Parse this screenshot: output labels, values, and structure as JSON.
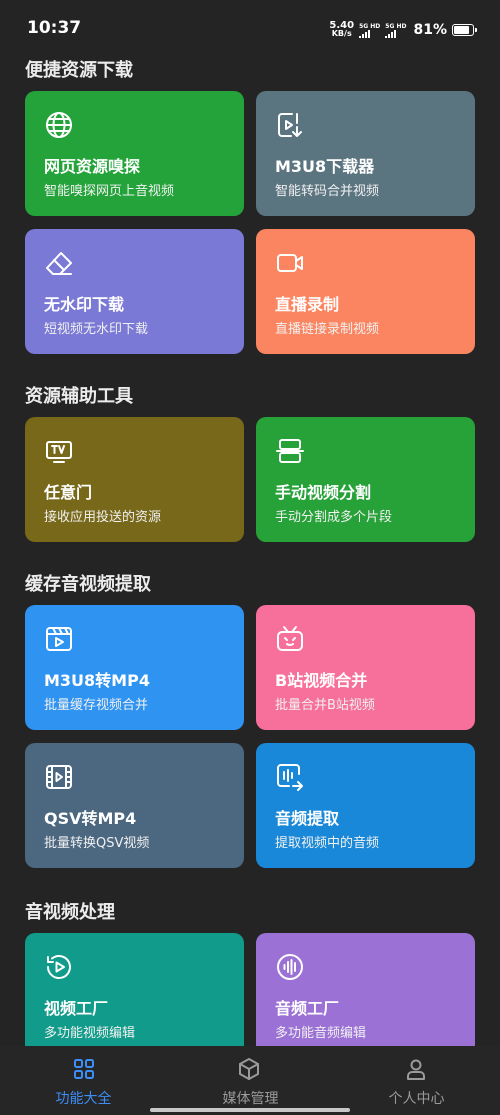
{
  "status": {
    "time": "10:37",
    "net_speed_value": "5.40",
    "net_speed_unit": "KB/s",
    "sim1_label": "5G HD",
    "sim2_label": "5G HD",
    "battery_percent": "81%",
    "battery_level": 0.81
  },
  "sections": [
    {
      "title": "便捷资源下载",
      "cards": [
        {
          "title": "网页资源嗅探",
          "subtitle": "智能嗅探网页上音视频",
          "color": "#24a33a",
          "icon": "globe-icon"
        },
        {
          "title": "M3U8下载器",
          "subtitle": "智能转码合并视频",
          "color": "#5a7480",
          "icon": "video-download-icon"
        },
        {
          "title": "无水印下载",
          "subtitle": "短视频无水印下载",
          "color": "#7a79d6",
          "icon": "eraser-icon"
        },
        {
          "title": "直播录制",
          "subtitle": "直播链接录制视频",
          "color": "#fb8560",
          "icon": "video-camera-icon"
        }
      ]
    },
    {
      "title": "资源辅助工具",
      "cards": [
        {
          "title": "任意门",
          "subtitle": "接收应用投送的资源",
          "color": "#77681a",
          "icon": "tv-icon"
        },
        {
          "title": "手动视频分割",
          "subtitle": "手动分割成多个片段",
          "color": "#26a239",
          "icon": "split-icon"
        }
      ]
    },
    {
      "title": "缓存音视频提取",
      "cards": [
        {
          "title": "M3U8转MP4",
          "subtitle": "批量缓存视频合并",
          "color": "#2f93f2",
          "icon": "video-clip-icon"
        },
        {
          "title": "B站视频合并",
          "subtitle": "批量合并B站视频",
          "color": "#f7709b",
          "icon": "bilibili-icon"
        },
        {
          "title": "QSV转MP4",
          "subtitle": "批量转换QSV视频",
          "color": "#4c6780",
          "icon": "film-icon"
        },
        {
          "title": "音频提取",
          "subtitle": "提取视频中的音频",
          "color": "#1a88d8",
          "icon": "audio-extract-icon"
        }
      ]
    },
    {
      "title": "音视频处理",
      "cards": [
        {
          "title": "视频工厂",
          "subtitle": "多功能视频编辑",
          "color": "#119b8a",
          "icon": "play-circle-icon"
        },
        {
          "title": "音频工厂",
          "subtitle": "多功能音频编辑",
          "color": "#9b71d6",
          "icon": "audio-wave-icon"
        }
      ]
    }
  ],
  "nav": [
    {
      "label": "功能大全",
      "icon": "grid-icon",
      "active": true
    },
    {
      "label": "媒体管理",
      "icon": "box-icon",
      "active": false
    },
    {
      "label": "个人中心",
      "icon": "person-icon",
      "active": false
    }
  ],
  "colors": {
    "background": "#242424",
    "nav_active": "#3d8ef5",
    "nav_inactive": "#9a9a9a"
  }
}
